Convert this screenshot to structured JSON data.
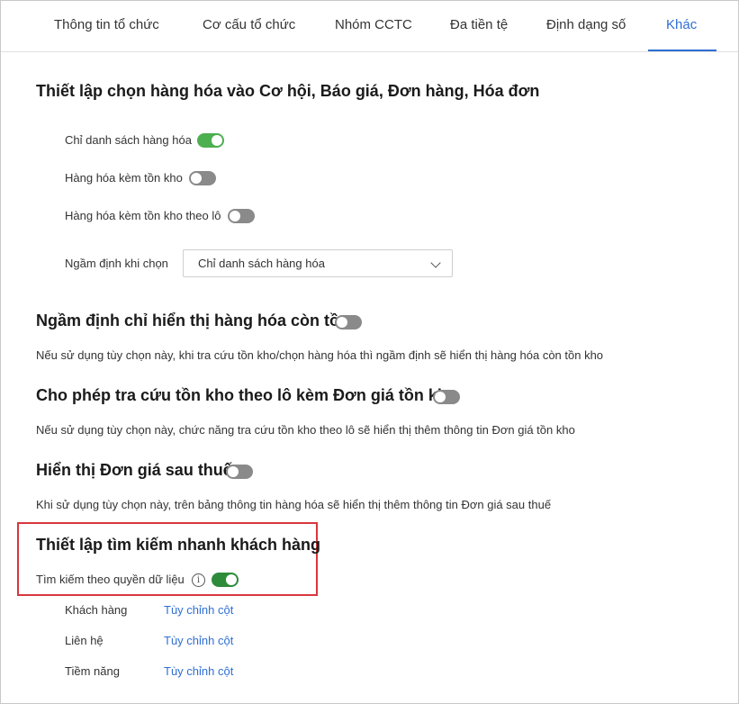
{
  "tabs": [
    {
      "label": "Thông tin tổ chức"
    },
    {
      "label": "Cơ cấu tổ chức"
    },
    {
      "label": "Nhóm CCTC"
    },
    {
      "label": "Đa tiền tệ"
    },
    {
      "label": "Định dạng số"
    },
    {
      "label": "Khác",
      "active": true
    }
  ],
  "section_products": {
    "title": "Thiết lập chọn hàng hóa vào Cơ hội, Báo giá, Đơn hàng, Hóa đơn",
    "options": [
      {
        "label": "Chỉ danh sách hàng hóa",
        "enabled": true
      },
      {
        "label": "Hàng hóa kèm tồn kho",
        "enabled": false
      },
      {
        "label": "Hàng hóa kèm tồn kho theo lô",
        "enabled": false
      }
    ],
    "default_label": "Ngầm định khi chọn",
    "default_value": "Chỉ danh sách hàng hóa"
  },
  "section_instock": {
    "title": "Ngầm định chỉ hiển thị hàng hóa còn tồn",
    "enabled": false,
    "description": "Nếu sử dụng tùy chọn này, khi tra cứu tồn kho/chọn hàng hóa thì ngầm định sẽ hiển thị hàng hóa còn tồn kho"
  },
  "section_lot_price": {
    "title": "Cho phép tra cứu tồn kho theo lô kèm Đơn giá tồn kho",
    "enabled": false,
    "description": "Nếu sử dụng tùy chọn này, chức năng tra cứu tồn kho theo lô sẽ hiển thị thêm thông tin Đơn giá tồn kho"
  },
  "section_after_tax": {
    "title": "Hiển thị Đơn giá sau thuế",
    "enabled": false,
    "description": "Khi sử dụng tùy chọn này, trên bảng thông tin hàng hóa sẽ hiển thị thêm thông tin Đơn giá sau thuế"
  },
  "section_quick_search": {
    "title": "Thiết lập tìm kiếm nhanh khách hàng",
    "permission_label": "Tìm kiếm theo quyền dữ liệu",
    "permission_enabled": true,
    "info_glyph": "i",
    "rows": [
      {
        "label": "Khách hàng",
        "link": "Tùy chỉnh cột"
      },
      {
        "label": "Liên hệ",
        "link": "Tùy chỉnh cột"
      },
      {
        "label": "Tiềm năng",
        "link": "Tùy chỉnh cột"
      }
    ]
  },
  "colors": {
    "accent": "#2f6fd4",
    "toggle_on": "#4caf50",
    "toggle_off": "#8a8a8a",
    "highlight": "#d9363e"
  }
}
